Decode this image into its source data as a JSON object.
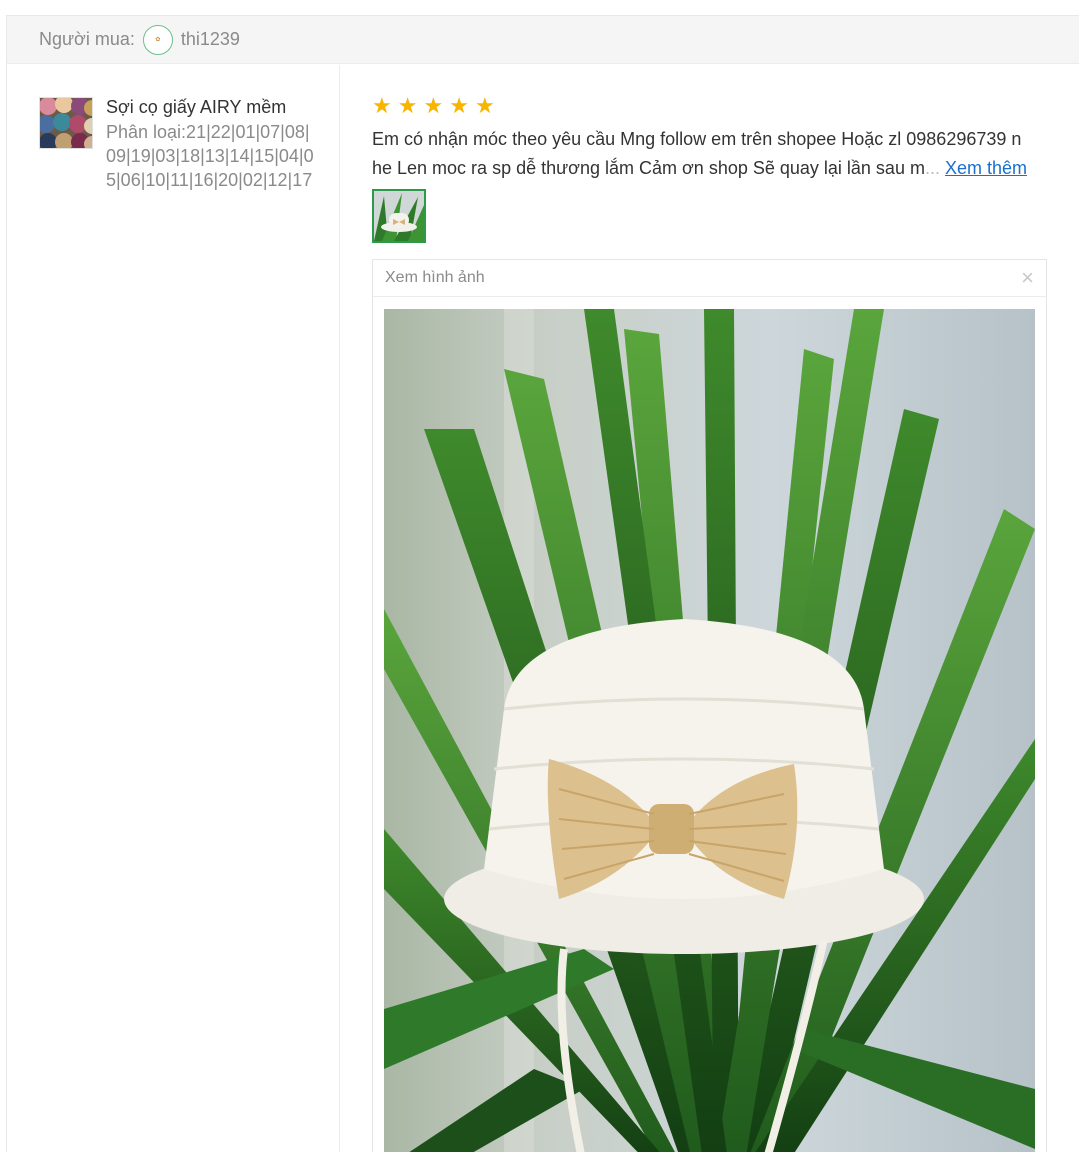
{
  "header": {
    "buyer_label": "Người mua:",
    "username": "thi1239"
  },
  "product": {
    "title": "Sợi cọ giấy AIRY mềm",
    "variant": "Phân loại:21|22|01|07|08|09|19|03|18|13|14|15|04|05|06|10|11|16|20|02|12|17"
  },
  "review": {
    "rating": 5,
    "line1": "Em có nhận móc theo yêu cầu Mng follow em trên shopee Hoặc zl 0986296739 n",
    "line2": "he Len moc ra sp dễ thương lắm Cảm ơn shop Sẽ quay lại lần sau m",
    "ellipsis": "...",
    "see_more": "Xem thêm"
  },
  "viewer": {
    "title": "Xem hình ảnh",
    "close": "×"
  },
  "colors": {
    "star": "#f7b500",
    "link": "#1a6fd1"
  }
}
